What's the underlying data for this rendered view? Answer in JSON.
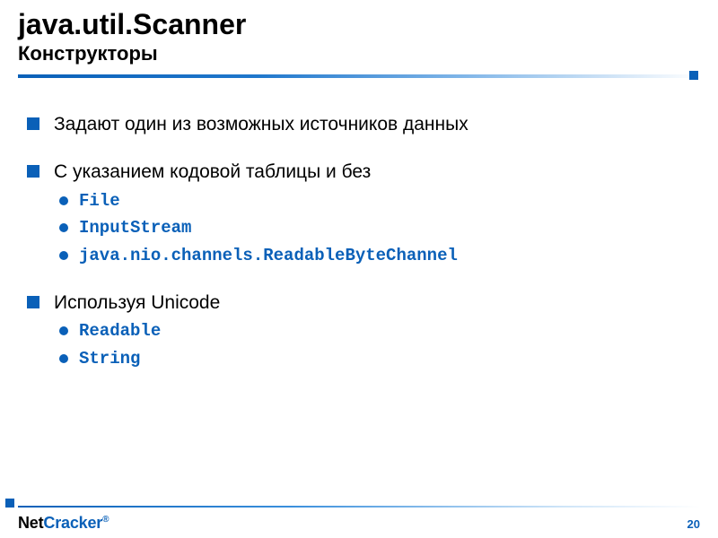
{
  "header": {
    "title": "java.util.Scanner",
    "subtitle": "Конструкторы"
  },
  "bullets": {
    "b1": "Задают один из возможных источников данных",
    "b2": "С указанием кодовой таблицы и без",
    "b2_items": {
      "i1": "File",
      "i2": "InputStream",
      "i3": "java.nio.channels.ReadableByteChannel"
    },
    "b3": "Используя Unicode",
    "b3_items": {
      "i1": "Readable",
      "i2": "String"
    }
  },
  "footer": {
    "logo_left": "Net",
    "logo_right": "Cracker",
    "reg": "®",
    "page": "20"
  }
}
